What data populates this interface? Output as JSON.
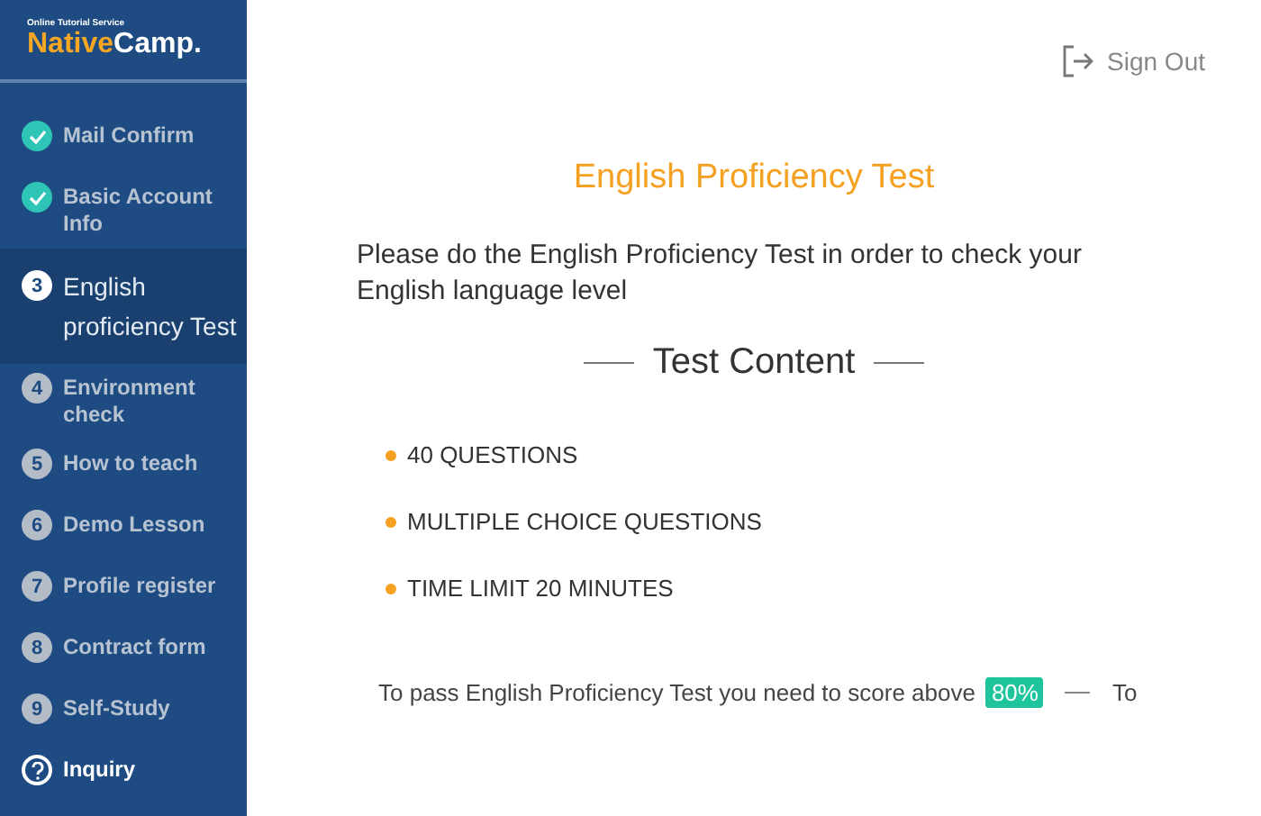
{
  "logo": {
    "tagline": "Online Tutorial Service",
    "brand_first": "Native",
    "brand_second": "Camp."
  },
  "steps": [
    {
      "kind": "done",
      "label": "Mail Confirm"
    },
    {
      "kind": "done",
      "label": "Basic Account Info"
    },
    {
      "kind": "current",
      "number": "3",
      "label": "English proficiency Test"
    },
    {
      "kind": "todo",
      "number": "4",
      "label": "Environment check"
    },
    {
      "kind": "todo",
      "number": "5",
      "label": "How to teach"
    },
    {
      "kind": "todo",
      "number": "6",
      "label": "Demo Lesson"
    },
    {
      "kind": "todo",
      "number": "7",
      "label": "Profile register"
    },
    {
      "kind": "todo",
      "number": "8",
      "label": "Contract form"
    },
    {
      "kind": "todo",
      "number": "9",
      "label": "Self-Study"
    },
    {
      "kind": "help",
      "label": "Inquiry"
    }
  ],
  "sign_out": "Sign Out",
  "title": "English Proficiency Test",
  "intro": "Please do the English Proficiency Test in order to check your English language level",
  "section_heading": "Test Content",
  "content_items": [
    "40 QUESTIONS",
    "MULTIPLE CHOICE QUESTIONS",
    "TIME LIMIT 20 MINUTES"
  ],
  "pass_note": {
    "text": "To pass English Proficiency Test you need to score above",
    "score": "80%",
    "trailing": "To"
  }
}
